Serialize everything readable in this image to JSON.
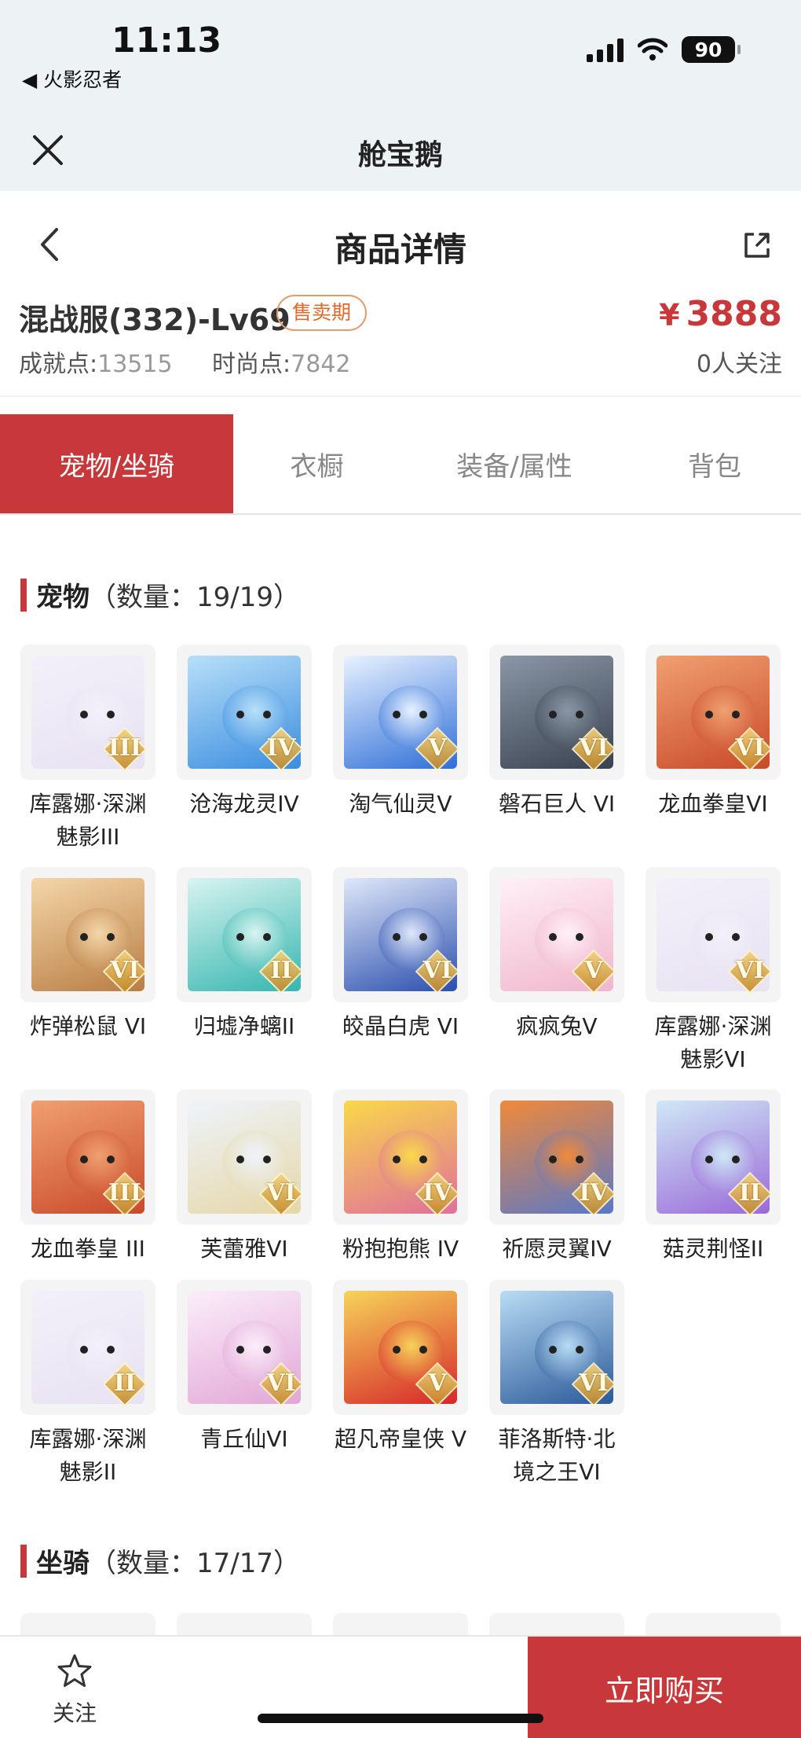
{
  "status_bar": {
    "time": "11:13",
    "back_app": "◀ 火影忍者",
    "battery": "90"
  },
  "mini_header": {
    "title": "舱宝鹅"
  },
  "page": {
    "title": "商品详情"
  },
  "product": {
    "name": "混战服(332)-Lv69",
    "badge": "售卖期",
    "currency": "¥",
    "price": "3888",
    "achievement_label": "成就点:",
    "achievement_value": "13515",
    "fashion_label": "时尚点:",
    "fashion_value": "7842",
    "followers": "0人关注"
  },
  "tabs": [
    {
      "label": "宠物/坐骑",
      "active": true
    },
    {
      "label": "衣橱",
      "active": false
    },
    {
      "label": "装备/属性",
      "active": false
    },
    {
      "label": "背包",
      "active": false
    }
  ],
  "pets_section": {
    "name": "宠物",
    "count": "（数量：19/19）"
  },
  "mounts_section": {
    "name": "坐骑",
    "count": "（数量：17/17）"
  },
  "pets": [
    {
      "label": "库露娜·深渊魅影III",
      "rank": "III",
      "colors": [
        "#e8e2f2",
        "#f3f0fa"
      ]
    },
    {
      "label": "沧海龙灵IV",
      "rank": "IV",
      "colors": [
        "#3a8de0",
        "#b8e0f8"
      ]
    },
    {
      "label": "淘气仙灵V",
      "rank": "V",
      "colors": [
        "#2f6fd8",
        "#e8f2ff"
      ]
    },
    {
      "label": "磐石巨人 VI",
      "rank": "VI",
      "colors": [
        "#3a4250",
        "#8a97a6"
      ]
    },
    {
      "label": "龙血拳皇VI",
      "rank": "VI",
      "colors": [
        "#c94a2a",
        "#f0a070"
      ]
    },
    {
      "label": "炸弹松鼠 VI",
      "rank": "VI",
      "colors": [
        "#b97d44",
        "#f4d6a8"
      ]
    },
    {
      "label": "归墟净螭II",
      "rank": "II",
      "colors": [
        "#36b6b0",
        "#d8f4f0"
      ]
    },
    {
      "label": "皎晶白虎 VI",
      "rank": "VI",
      "colors": [
        "#2b4fae",
        "#dfe8fa"
      ]
    },
    {
      "label": "疯疯兔V",
      "rank": "V",
      "colors": [
        "#f0b6cc",
        "#fff0f6"
      ]
    },
    {
      "label": "库露娜·深渊魅影VI",
      "rank": "VI",
      "colors": [
        "#e8e2f2",
        "#f3f0fa"
      ]
    },
    {
      "label": "龙血拳皇 III",
      "rank": "III",
      "colors": [
        "#c94a2a",
        "#f0a070"
      ]
    },
    {
      "label": "芙蕾雅VI",
      "rank": "VI",
      "colors": [
        "#e6d7a8",
        "#eef4fb"
      ]
    },
    {
      "label": "粉抱抱熊 IV",
      "rank": "IV",
      "colors": [
        "#e0709a",
        "#f9d84a"
      ]
    },
    {
      "label": "祈愿灵翼IV",
      "rank": "IV",
      "colors": [
        "#5a78c8",
        "#f0893a"
      ]
    },
    {
      "label": "菇灵荆怪II",
      "rank": "II",
      "colors": [
        "#9a6ad8",
        "#cfe8f6"
      ]
    },
    {
      "label": "库露娜·深渊魅影II",
      "rank": "II",
      "colors": [
        "#e8e2f2",
        "#f3f0fa"
      ]
    },
    {
      "label": "青丘仙VI",
      "rank": "VI",
      "colors": [
        "#e2a6d6",
        "#fbeefa"
      ]
    },
    {
      "label": "超凡帝皇侠 V",
      "rank": "V",
      "colors": [
        "#d6282a",
        "#f7d35a"
      ]
    },
    {
      "label": "菲洛斯特·北境之王VI",
      "rank": "VI",
      "colors": [
        "#2c5a9a",
        "#b8dcf4"
      ]
    }
  ],
  "bottom_bar": {
    "follow_label": "关注",
    "buy_label": "立即购买"
  },
  "colors": {
    "accent": "#c8373a",
    "badge": "#e06a2a"
  }
}
